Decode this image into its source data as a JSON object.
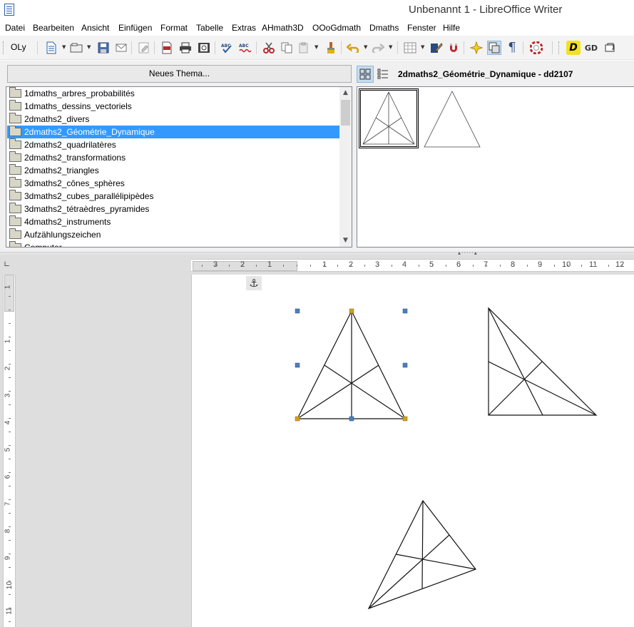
{
  "window": {
    "title": "Unbenannt 1 - LibreOffice Writer"
  },
  "menubar": {
    "items": [
      "Datei",
      "Bearbeiten",
      "Ansicht",
      "Einfügen",
      "Format",
      "Tabelle",
      "Extras",
      "AHmath3D",
      "OOoGdmath",
      "Dmaths",
      "Fenster",
      "Hilfe"
    ]
  },
  "toolbar": {
    "font_label": "OLy",
    "icons": [
      "new-document-icon",
      "open-icon",
      "save-icon",
      "email-icon",
      "edit-mode-icon",
      "export-pdf-icon",
      "print-icon",
      "print-preview-icon",
      "spellcheck-icon",
      "autospellcheck-icon",
      "cut-icon",
      "copy-icon",
      "paste-icon",
      "clone-formatting-icon",
      "undo-icon",
      "redo-icon",
      "table-icon",
      "show-draw-functions-icon",
      "navigator-icon",
      "gallery-icon",
      "formatting-marks-icon",
      "help-icon",
      "dmaths-d-icon",
      "gd-icon",
      "gd-toolbox-icon"
    ],
    "gd_label": "GD",
    "d_label": "D"
  },
  "gallery": {
    "new_theme_label": "Neues Thema...",
    "themes": [
      "1dmaths_arbres_probabilités",
      "1dmaths_dessins_vectoriels",
      "2dmaths2_divers",
      "2dmaths2_Géométrie_Dynamique",
      "2dmaths2_quadrilatères",
      "2dmaths2_transformations",
      "2dmaths2_triangles",
      "3dmaths2_cônes_sphères",
      "3dmaths2_cubes_parallélipipèdes",
      "3dmaths2_tétraèdres_pyramides",
      "4dmaths2_instruments",
      "Aufzählungszeichen",
      "Computer"
    ],
    "selected_theme": "2dmaths2_Géométrie_Dynamique",
    "title": "2dmaths2_Géométrie_Dynamique - dd2107"
  },
  "ruler": {
    "horizontal_numbers": [
      "3",
      "2",
      "1",
      "1",
      "2",
      "3",
      "4",
      "5",
      "6",
      "7",
      "8",
      "9",
      "10",
      "11",
      "12"
    ],
    "vertical_numbers": [
      "1",
      "1",
      "2",
      "3",
      "4",
      "5",
      "6",
      "7",
      "8",
      "9",
      "10",
      "11"
    ]
  },
  "document": {
    "anchor_icon": "anchor-icon",
    "shapes": [
      "selected-isosceles-triangle",
      "right-triangle",
      "scalene-triangle"
    ]
  },
  "colors": {
    "selection": "#3399ff",
    "handle_blue": "#4a7fc1",
    "handle_yellow": "#d4a017",
    "active_tool": "#c7dcef"
  }
}
